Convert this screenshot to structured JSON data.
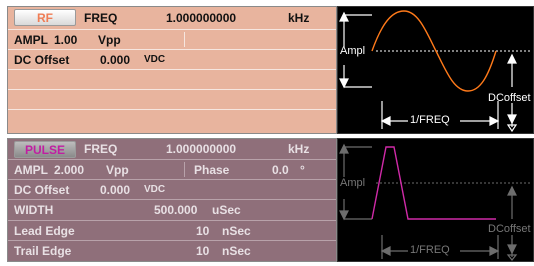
{
  "rf": {
    "tab": "RF",
    "freq_label": "FREQ",
    "freq_value": "1.000000000",
    "freq_unit": "kHz",
    "ampl_label": "AMPL",
    "ampl_value": "1.00",
    "ampl_unit": "Vpp",
    "dc_label": "DC Offset",
    "dc_value": "0.000",
    "dc_unit": "VDC",
    "graph": {
      "ampl": "Ampl",
      "dcoffset": "DCoffset",
      "period": "1/FREQ"
    }
  },
  "pulse": {
    "tab": "PULSE",
    "freq_label": "FREQ",
    "freq_value": "1.000000000",
    "freq_unit": "kHz",
    "ampl_label": "AMPL",
    "ampl_value": "2.000",
    "ampl_unit": "Vpp",
    "phase_label": "Phase",
    "phase_value": "0.0",
    "phase_unit": "°",
    "dc_label": "DC Offset",
    "dc_value": "0.000",
    "dc_unit": "VDC",
    "width_label": "WIDTH",
    "width_value": "500.000",
    "width_unit": "uSec",
    "lead_label": "Lead Edge",
    "lead_value": "10",
    "lead_unit": "nSec",
    "trail_label": "Trail Edge",
    "trail_value": "10",
    "trail_unit": "nSec",
    "graph": {
      "ampl": "Ampl",
      "dcoffset": "DCoffset",
      "period": "1/FREQ"
    }
  },
  "colors": {
    "rf_bg": "#e8b49e",
    "pulse_bg": "#8f6f7a",
    "sine": "#ff7a1a",
    "pulse_wave": "#d02aa8"
  }
}
